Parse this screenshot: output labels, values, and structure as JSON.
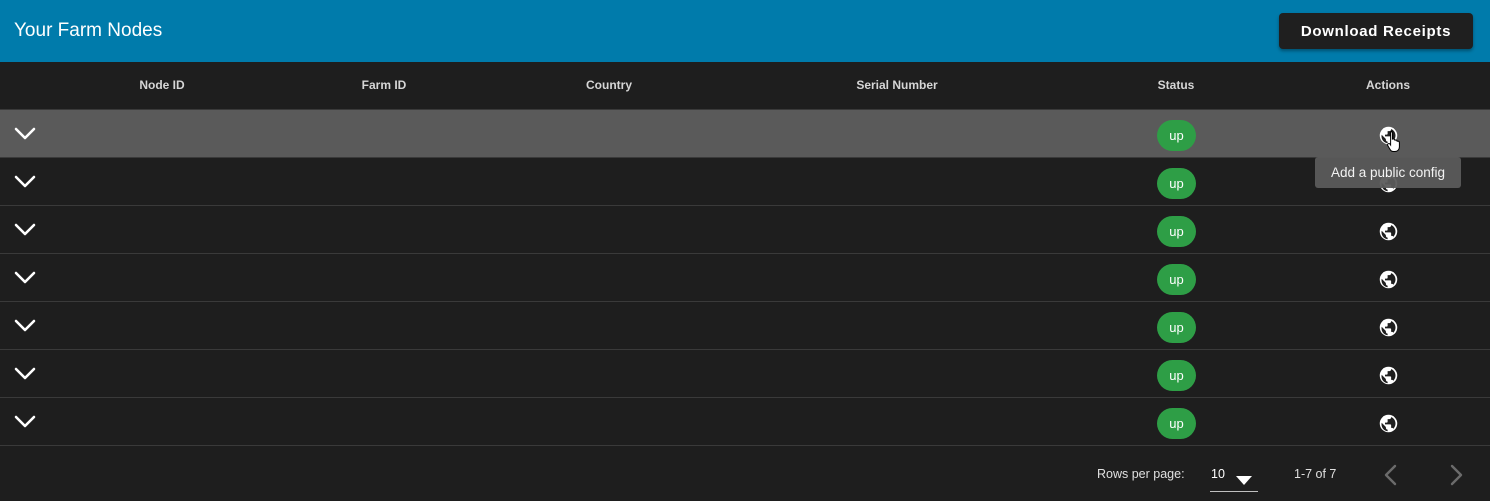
{
  "header": {
    "title": "Your Farm Nodes",
    "download_label": "Download Receipts",
    "bar_color": "#007bab"
  },
  "table": {
    "columns": [
      "Node ID",
      "Farm ID",
      "Country",
      "Serial Number",
      "Status",
      "Actions"
    ],
    "rows": [
      {
        "node_id": "",
        "farm_id": "",
        "country": "",
        "serial_number": "",
        "status": "up",
        "action_icon": "globe-icon",
        "hovered": true
      },
      {
        "node_id": "",
        "farm_id": "",
        "country": "",
        "serial_number": "",
        "status": "up",
        "action_icon": "globe-icon",
        "hovered": false
      },
      {
        "node_id": "",
        "farm_id": "",
        "country": "",
        "serial_number": "",
        "status": "up",
        "action_icon": "globe-icon",
        "hovered": false
      },
      {
        "node_id": "",
        "farm_id": "",
        "country": "",
        "serial_number": "",
        "status": "up",
        "action_icon": "globe-icon",
        "hovered": false
      },
      {
        "node_id": "",
        "farm_id": "",
        "country": "",
        "serial_number": "",
        "status": "up",
        "action_icon": "globe-icon",
        "hovered": false
      },
      {
        "node_id": "",
        "farm_id": "",
        "country": "",
        "serial_number": "",
        "status": "up",
        "action_icon": "globe-icon",
        "hovered": false
      },
      {
        "node_id": "",
        "farm_id": "",
        "country": "",
        "serial_number": "",
        "status": "up",
        "action_icon": "globe-icon",
        "hovered": false
      }
    ],
    "status_color": "#2e9e46"
  },
  "tooltip": {
    "text": "Add a public config"
  },
  "pagination": {
    "rows_per_page_label": "Rows per page:",
    "rows_per_page_value": "10",
    "range_text": "1-7 of 7"
  }
}
